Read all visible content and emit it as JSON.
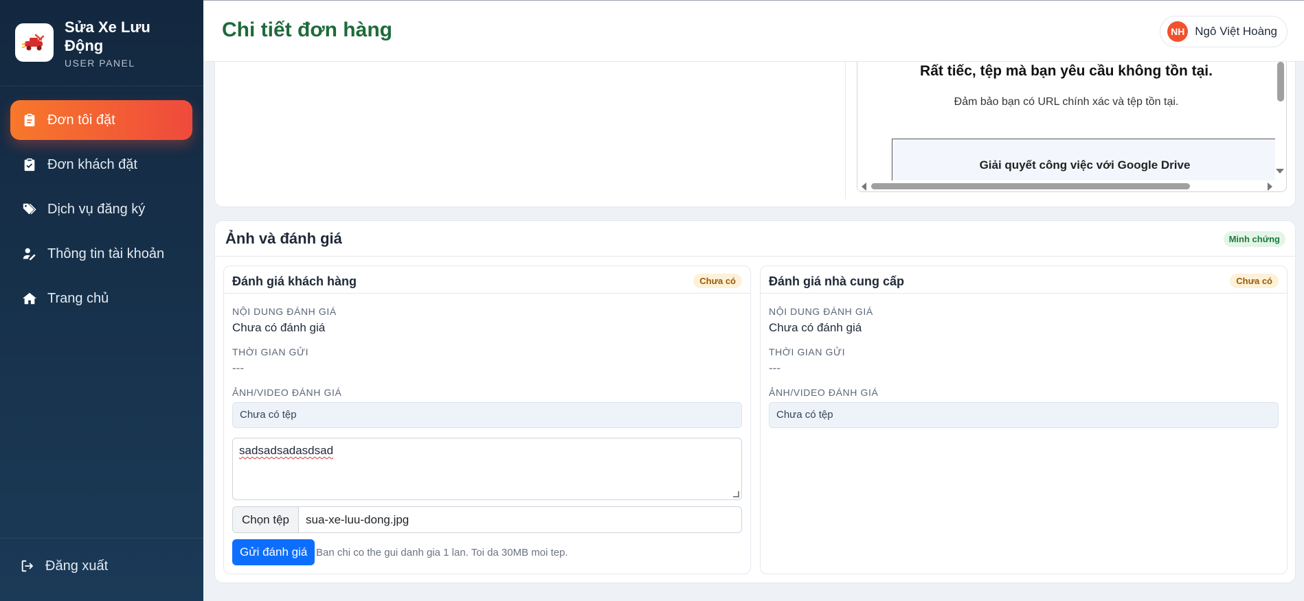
{
  "brand": {
    "title": "Sửa Xe Lưu Động",
    "subtitle": "USER PANEL",
    "logo_icon": "mobile-repair-truck-icon"
  },
  "sidebar": {
    "items": [
      {
        "label": "Đơn tôi đặt",
        "icon": "clipboard-icon",
        "active": true
      },
      {
        "label": "Đơn khách đặt",
        "icon": "clipboard-check-icon",
        "active": false
      },
      {
        "label": "Dịch vụ đăng ký",
        "icon": "tags-icon",
        "active": false
      },
      {
        "label": "Thông tin tài khoản",
        "icon": "user-edit-icon",
        "active": false
      },
      {
        "label": "Trang chủ",
        "icon": "home-icon",
        "active": false
      }
    ],
    "logout_label": "Đăng xuất"
  },
  "header": {
    "title": "Chi tiết đơn hàng",
    "user_initials": "NH",
    "user_name": "Ngô Việt Hoàng"
  },
  "preview": {
    "title": "Rất tiếc, tệp mà bạn yêu cầu không tồn tại.",
    "subtitle": "Đảm bảo bạn có URL chính xác và tệp tồn tại.",
    "box_text": "Giải quyết công việc với Google Drive"
  },
  "reviews_section": {
    "title": "Ảnh và đánh giá",
    "badge": "Minh chứng",
    "customer": {
      "title": "Đánh giá khách hàng",
      "status": "Chưa có",
      "content_label": "Nội dung đánh giá",
      "content_value": "Chưa có đánh giá",
      "time_label": "Thời gian gửi",
      "time_value": "---",
      "media_label": "Ảnh/Video đánh giá",
      "media_value": "Chưa có tệp",
      "textarea_value": "sadsadsadasdsad",
      "file_button": "Chọn tệp",
      "file_name": "sua-xe-luu-dong.jpg",
      "submit_label": "Gửi đánh giá",
      "note": "Ban chi co the gui danh gia 1 lan. Toi da 30MB moi tep."
    },
    "provider": {
      "title": "Đánh giá nhà cung cấp",
      "status": "Chưa có",
      "content_label": "Nội dung đánh giá",
      "content_value": "Chưa có đánh giá",
      "time_label": "Thời gian gửi",
      "time_value": "---",
      "media_label": "Ảnh/Video đánh giá",
      "media_value": "Chưa có tệp"
    }
  },
  "colors": {
    "sidebar_bg": "#13283f",
    "active_gradient_start": "#f7782b",
    "active_gradient_end": "#ef4a3c",
    "title_green": "#1e6a3a",
    "primary_button": "#0d6efd"
  }
}
